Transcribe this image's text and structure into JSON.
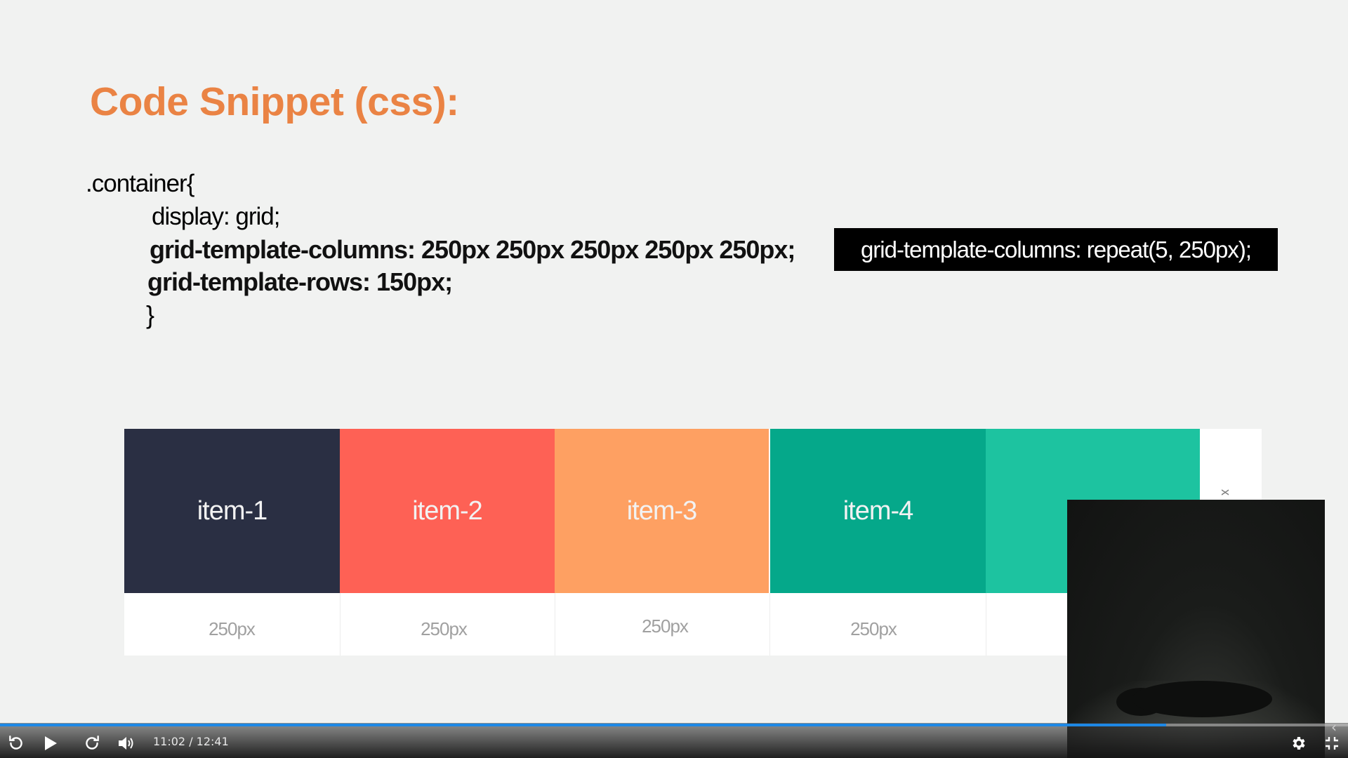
{
  "slide": {
    "title": "Code Snippet (css):",
    "code_lines": [
      ".container{",
      "display: grid;",
      "grid-template-columns: 250px 250px 250px 250px 250px;",
      "grid-template-rows: 150px;",
      "}"
    ],
    "callout": "grid-template-columns: repeat(5, 250px);",
    "grid_items": [
      {
        "label": "item-1",
        "color": "#2a2f43",
        "size": "250px"
      },
      {
        "label": "item-2",
        "color": "#fe6155",
        "size": "250px"
      },
      {
        "label": "item-3",
        "color": "#fea062",
        "size": "250px"
      },
      {
        "label": "item-4",
        "color": "#05a88a",
        "size": "250px"
      },
      {
        "label": "i",
        "color": "#1dc3a0",
        "size": ""
      }
    ],
    "side_mark": "x"
  },
  "player": {
    "current_time": "11:02",
    "duration": "12:41",
    "time_display": "11:02 / 12:41",
    "progress": 0.865,
    "accent_color": "#1e88e5",
    "icons": {
      "rewind": "replay-icon",
      "play": "play-icon",
      "forward": "forward-icon",
      "volume": "volume-icon",
      "settings": "gear-icon",
      "exit_fullscreen": "exit-fullscreen-icon"
    }
  }
}
